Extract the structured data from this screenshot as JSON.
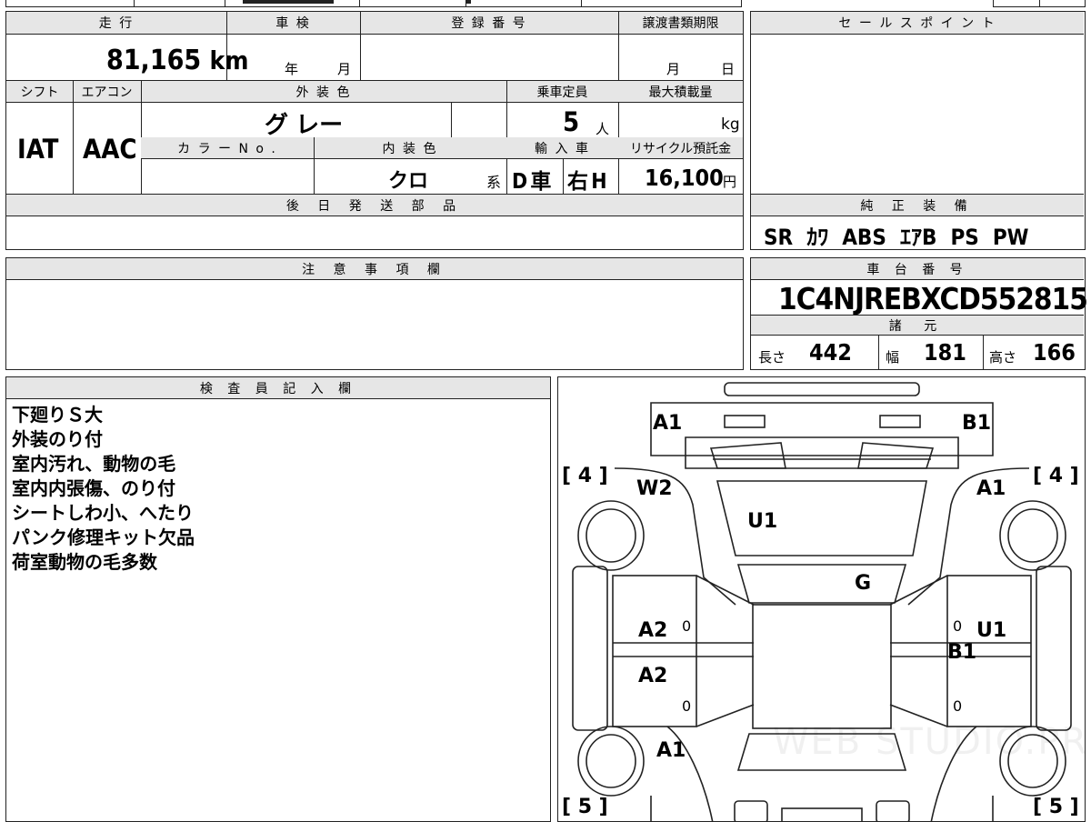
{
  "top_fragment": "",
  "mileage": {
    "label": "走 行",
    "value": "81,165",
    "unit": "km"
  },
  "inspection": {
    "label": "車 検",
    "year": "年",
    "month": "月"
  },
  "registration": {
    "label": "登 録 番 号",
    "value": ""
  },
  "transfer_deadline": {
    "label": "譲渡書類期限",
    "month": "月",
    "day": "日"
  },
  "sales_point": {
    "label": "セ ー ル ス ポ イ ン ト",
    "text": ""
  },
  "shift": {
    "label": "シフト",
    "value": "IAT"
  },
  "aircon": {
    "label": "エアコン",
    "value": "AAC"
  },
  "exterior_color": {
    "label": "外 装 色",
    "value": "グ レー"
  },
  "capacity": {
    "label": "乗車定員",
    "value": "5",
    "unit": "人"
  },
  "max_load": {
    "label": "最大積載量",
    "unit": "kg"
  },
  "color_no": {
    "label": "カ ラ ー N o ."
  },
  "interior_color": {
    "label": "内 装 色",
    "value": "クロ",
    "suffix": "系"
  },
  "import": {
    "label": "輸 入 車",
    "d": "D 車",
    "h": "右 H"
  },
  "recycle": {
    "label": "リサイクル預託金",
    "value": "16,100",
    "unit": "円"
  },
  "later_parts": {
    "label": "後 日 発 送 部 品"
  },
  "equipment": {
    "label": "純 正 装 備",
    "value": "SR  ｶﾜ  ABS  ｴｱB  PS  PW"
  },
  "caution": {
    "label": "注 意 事 項 欄"
  },
  "chassis": {
    "label": "車 台 番 号",
    "value": "1C4NJREBXCD552815"
  },
  "specs": {
    "label": "諸 元",
    "length_label": "長さ",
    "length": "442",
    "width_label": "幅",
    "width": "181",
    "height_label": "高さ",
    "height": "166"
  },
  "inspector": {
    "label": "検 査 員 記 入 欄",
    "notes": [
      "下廻りＳ大",
      "外装のり付",
      "室内汚れ、動物の毛",
      "室内内張傷、のり付",
      "シートしわ小、へたり",
      "パンク修理キット欠品",
      "荷室動物の毛多数"
    ]
  },
  "diagram": {
    "marks": [
      "A1",
      "B1",
      "W2",
      "A1",
      "U1",
      "G",
      "A2",
      "A2",
      "U1",
      "B1",
      "A1"
    ],
    "tires": [
      "[ 4 ]",
      "[ 4 ]",
      "[ 5 ]",
      "[ 5 ]"
    ],
    "zeros": [
      "0",
      "0",
      "0",
      "0"
    ],
    "watermark": "WEB STUDIO.PRO"
  }
}
